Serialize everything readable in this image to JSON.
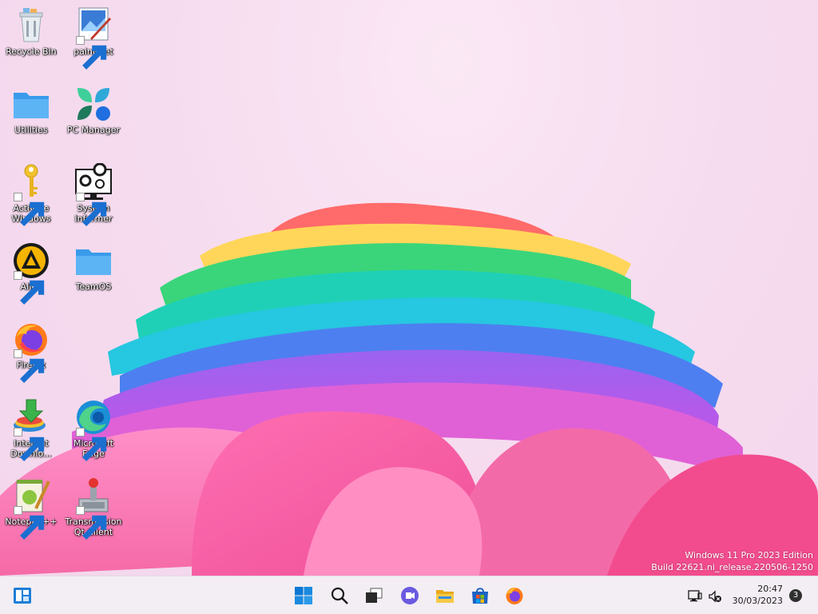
{
  "desktop": {
    "icons": [
      {
        "label": "Recycle Bin",
        "icon": "recycle-bin-icon"
      },
      {
        "label": "paint.net",
        "icon": "paintnet-icon"
      },
      {
        "label": "Utilities",
        "icon": "folder-icon"
      },
      {
        "label": "PC Manager",
        "icon": "pc-manager-icon"
      },
      {
        "label": "Activate Windows",
        "icon": "key-icon"
      },
      {
        "label": "System Informer",
        "icon": "system-informer-icon"
      },
      {
        "label": "AIMP",
        "icon": "aimp-icon"
      },
      {
        "label": "TeamOS",
        "icon": "folder-icon"
      },
      {
        "label": "Firefox",
        "icon": "firefox-icon"
      },
      {
        "label": "Internet Downlo...",
        "icon": "idm-icon"
      },
      {
        "label": "Microsoft Edge",
        "icon": "edge-icon"
      },
      {
        "label": "Notepad++",
        "icon": "notepadpp-icon"
      },
      {
        "label": "Transmission Qt Client",
        "icon": "transmission-icon"
      }
    ],
    "watermark": {
      "line1": "Windows 11 Pro 2023 Edition",
      "line2": "Build 22621.ni_release.220506-1250"
    }
  },
  "taskbar": {
    "widgets_icon": "widgets-icon",
    "pinned": [
      {
        "name": "start",
        "icon": "windows-start-icon"
      },
      {
        "name": "search",
        "icon": "search-icon"
      },
      {
        "name": "task-view",
        "icon": "task-view-icon"
      },
      {
        "name": "chat",
        "icon": "teams-chat-icon"
      },
      {
        "name": "file-explorer",
        "icon": "file-explorer-icon"
      },
      {
        "name": "store",
        "icon": "microsoft-store-icon"
      },
      {
        "name": "firefox",
        "icon": "firefox-icon"
      }
    ],
    "tray": {
      "network_icon": "network-icon",
      "volume_icon": "volume-muted-icon",
      "time": "20:47",
      "date": "30/03/2023",
      "notifications": "3"
    }
  },
  "colors": {
    "background": "#f6dcef",
    "taskbar": "#f3eef3",
    "accent_blue": "#0078d4"
  }
}
